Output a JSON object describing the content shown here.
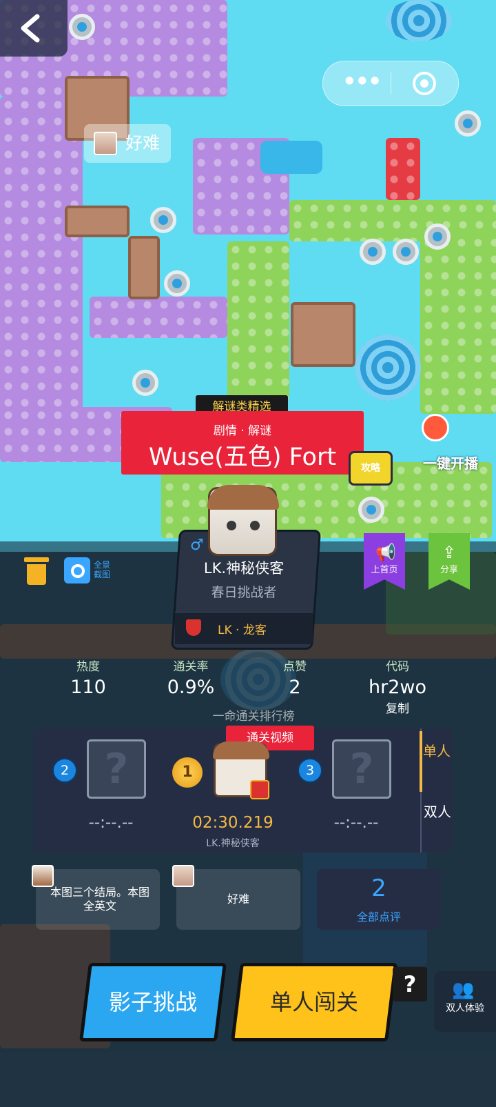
{
  "level": {
    "featured_tag": "解谜类精选",
    "genre": "剧情 · 解谜",
    "name": "Wuse(五色) Fort",
    "strategy_label": "攻略",
    "live_label": "一键开播"
  },
  "comment_bubble": {
    "text": "好难"
  },
  "tools": {
    "snapshot_label": "全景截图",
    "home_label": "上首页",
    "share_label": "分享"
  },
  "author": {
    "gender": "♂",
    "name": "LK.神秘侠客",
    "title": "春日挑战者",
    "clan": "LK · 龙客"
  },
  "stats": {
    "heat_label": "热度",
    "heat": "110",
    "pass_rate_label": "通关率",
    "pass_rate": "0.9%",
    "likes_label": "点赞",
    "likes": "2",
    "code_label": "代码",
    "code": "hr2wo",
    "copy_label": "复制"
  },
  "ranking": {
    "title": "一命通关排行榜",
    "video_tag": "通关视频",
    "slot_placeholder": "?",
    "first": {
      "rank": "1",
      "time": "02:30.219",
      "player": "LK.神秘侠客"
    },
    "second": {
      "rank": "2",
      "time": "--:--.--"
    },
    "third": {
      "rank": "3",
      "time": "--:--.--"
    },
    "mode_single": "单人",
    "mode_double": "双人"
  },
  "comments": [
    {
      "text": "本图三个结局。本图全英文"
    },
    {
      "text": "好难"
    }
  ],
  "all_comments": {
    "count": "2",
    "label": "全部点评"
  },
  "buttons": {
    "shadow_challenge": "影子挑战",
    "solo_play": "单人闯关",
    "help": "?",
    "duo_label": "双人体验"
  },
  "colors": {
    "accent_red": "#e8233a",
    "gold": "#f4b942",
    "blue": "#3aa6ff",
    "yellow_button": "#ffc21a",
    "blue_button": "#2ba6f0"
  }
}
